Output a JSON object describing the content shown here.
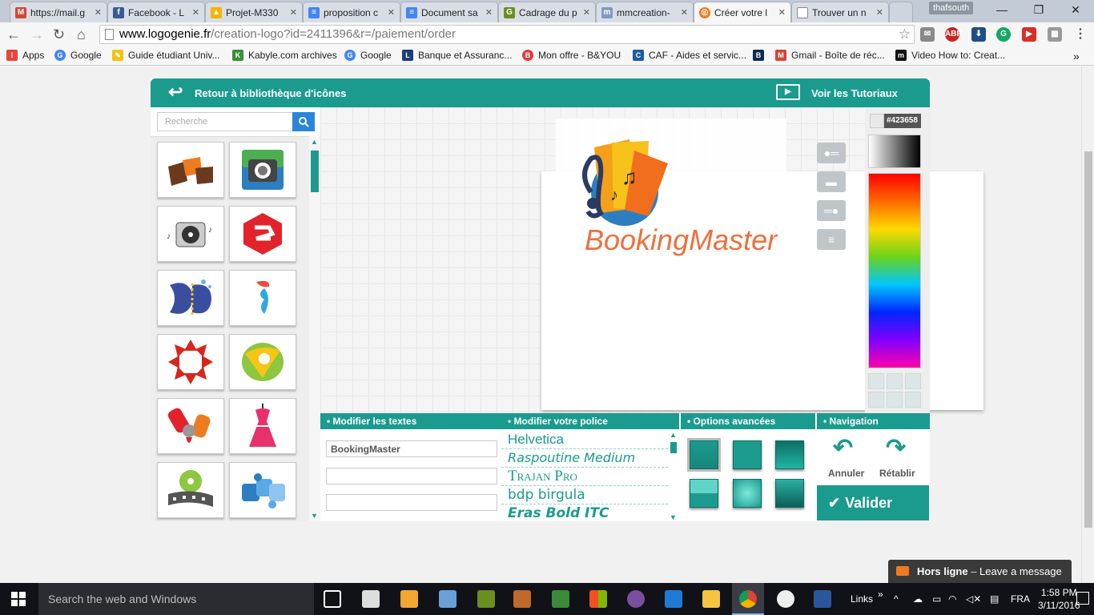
{
  "browser": {
    "tabs": [
      {
        "title": "https://mail.g",
        "favicon": "gmail-icon",
        "color": "#d44638"
      },
      {
        "title": "Facebook - L",
        "favicon": "facebook-icon",
        "color": "#3b5998"
      },
      {
        "title": "Projet-M330",
        "favicon": "drive-icon",
        "color": "#f4b400"
      },
      {
        "title": "proposition c",
        "favicon": "docs-icon",
        "color": "#4285f4"
      },
      {
        "title": "Document sa",
        "favicon": "docs-icon",
        "color": "#4285f4"
      },
      {
        "title": "Cadrage du p",
        "favicon": "go-icon",
        "color": "#6b8e23"
      },
      {
        "title": "mmcreation-",
        "favicon": "mm-icon",
        "color": "#7a9cc6"
      },
      {
        "title": "Créer votre l",
        "favicon": "logogenie-icon",
        "color": "#ef7b1f"
      },
      {
        "title": "Trouver un n",
        "favicon": "page-icon",
        "color": "#888888"
      }
    ],
    "active_tab_index": 7,
    "profile": "thafsouth",
    "url_host": "www.logogenie.fr",
    "url_path": "/creation-logo?id=2411396&r=/paiement/order",
    "bookmarks": [
      {
        "label": "Apps",
        "icon": "apps-grid-icon",
        "color": "#e8453c"
      },
      {
        "label": "Google",
        "icon": "google-icon",
        "color": "#4285f4"
      },
      {
        "label": "Guide étudiant Univ...",
        "icon": "guide-icon",
        "color": "#f4c20d"
      },
      {
        "label": "Kabyle.com archives",
        "icon": "kabyle-icon",
        "color": "#3b8e3b"
      },
      {
        "label": "Google",
        "icon": "google-icon",
        "color": "#4285f4"
      },
      {
        "label": "Banque et Assuranc...",
        "icon": "lcl-icon",
        "color": "#1d3c78"
      },
      {
        "label": "Mon offre - B&YOU",
        "icon": "byou-icon",
        "color": "#e03a3e"
      },
      {
        "label": "CAF - Aides et servic...",
        "icon": "caf-icon",
        "color": "#1e5aa8"
      },
      {
        "label": "",
        "icon": "bfm-icon",
        "color": "#0b2b57"
      },
      {
        "label": "Gmail - Boîte de réc...",
        "icon": "gmail-icon",
        "color": "#d44638"
      },
      {
        "label": "Video How to: Creat...",
        "icon": "m-icon",
        "color": "#111111"
      }
    ]
  },
  "editor": {
    "back_label": "Retour à bibliothèque d'icônes",
    "tutorials_label": "Voir les Tutoriaux",
    "search_placeholder": "Recherche",
    "color_hex": "#423658",
    "logo_text": "BookingMaster",
    "panels": {
      "texts": "Modifier les textes",
      "font": "Modifier votre police",
      "options": "Options avancées",
      "navigation": "Navigation"
    },
    "text_fields": [
      "BookingMaster",
      "",
      ""
    ],
    "fonts": [
      "Helvetica",
      "Raspoutine Medium",
      "Trajan Pro",
      "bdp birgula",
      "Eras Bold ITC"
    ],
    "undo_label": "Annuler",
    "redo_label": "Rétablir",
    "validate_label": "Valider",
    "accent_color": "#1a9b8e",
    "icon_names": [
      "tickets-icon",
      "camera-icon",
      "turntable-icon",
      "hexagon-s-icon",
      "fish-icon",
      "drink-icon",
      "star-arrows-icon",
      "leaf-circle-icon",
      "makeup-icon",
      "dress-icon",
      "film-reel-icon",
      "puzzle-icon"
    ]
  },
  "chat": {
    "label": "Hors ligne",
    "sub": "Leave a message"
  },
  "taskbar": {
    "search_placeholder": "Search the web and Windows",
    "links_label": "Links",
    "language": "FRA",
    "time": "1:58 PM",
    "date": "3/11/2016"
  }
}
